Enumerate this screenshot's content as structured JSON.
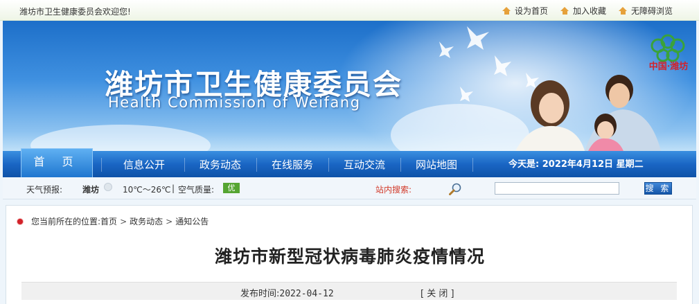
{
  "topbar": {
    "welcome": "潍坊市卫生健康委员会欢迎您!",
    "links": [
      {
        "label": "设为首页",
        "icon": "home-icon"
      },
      {
        "label": "加入收藏",
        "icon": "home-icon"
      },
      {
        "label": "无障碍浏览",
        "icon": "home-icon"
      }
    ]
  },
  "banner": {
    "title": "潍坊市卫生健康委员会",
    "subtitle": "Health Commission of Weifang",
    "logo_text": "中国·潍坊"
  },
  "nav": {
    "home": "首 页",
    "items": [
      "信息公开",
      "政务动态",
      "在线服务",
      "互动交流",
      "网站地图"
    ],
    "date": "今天是: 2022年4月12日 星期二"
  },
  "weather": {
    "label": "天气预报:",
    "city": "潍坊",
    "temp": "10℃～26℃",
    "sep": "|",
    "aq_label": "空气质量:",
    "aq_value": "优",
    "aq_color": "#55a532"
  },
  "search": {
    "label": "站内搜索:",
    "value": "",
    "button": "搜 索"
  },
  "breadcrumb": {
    "prefix": "您当前所在的位置:",
    "items": [
      "首页",
      "政务动态",
      "通知公告"
    ],
    "sep": ">"
  },
  "article": {
    "title": "潍坊市新型冠状病毒肺炎疫情情况",
    "publish_label": "发布时间:",
    "publish_date": "2022-04-12",
    "close": "[ 关 闭 ]"
  },
  "colors": {
    "nav_blue": "#1a66c4",
    "accent_red": "#d2222a",
    "icon_orange": "#e6a13b"
  }
}
